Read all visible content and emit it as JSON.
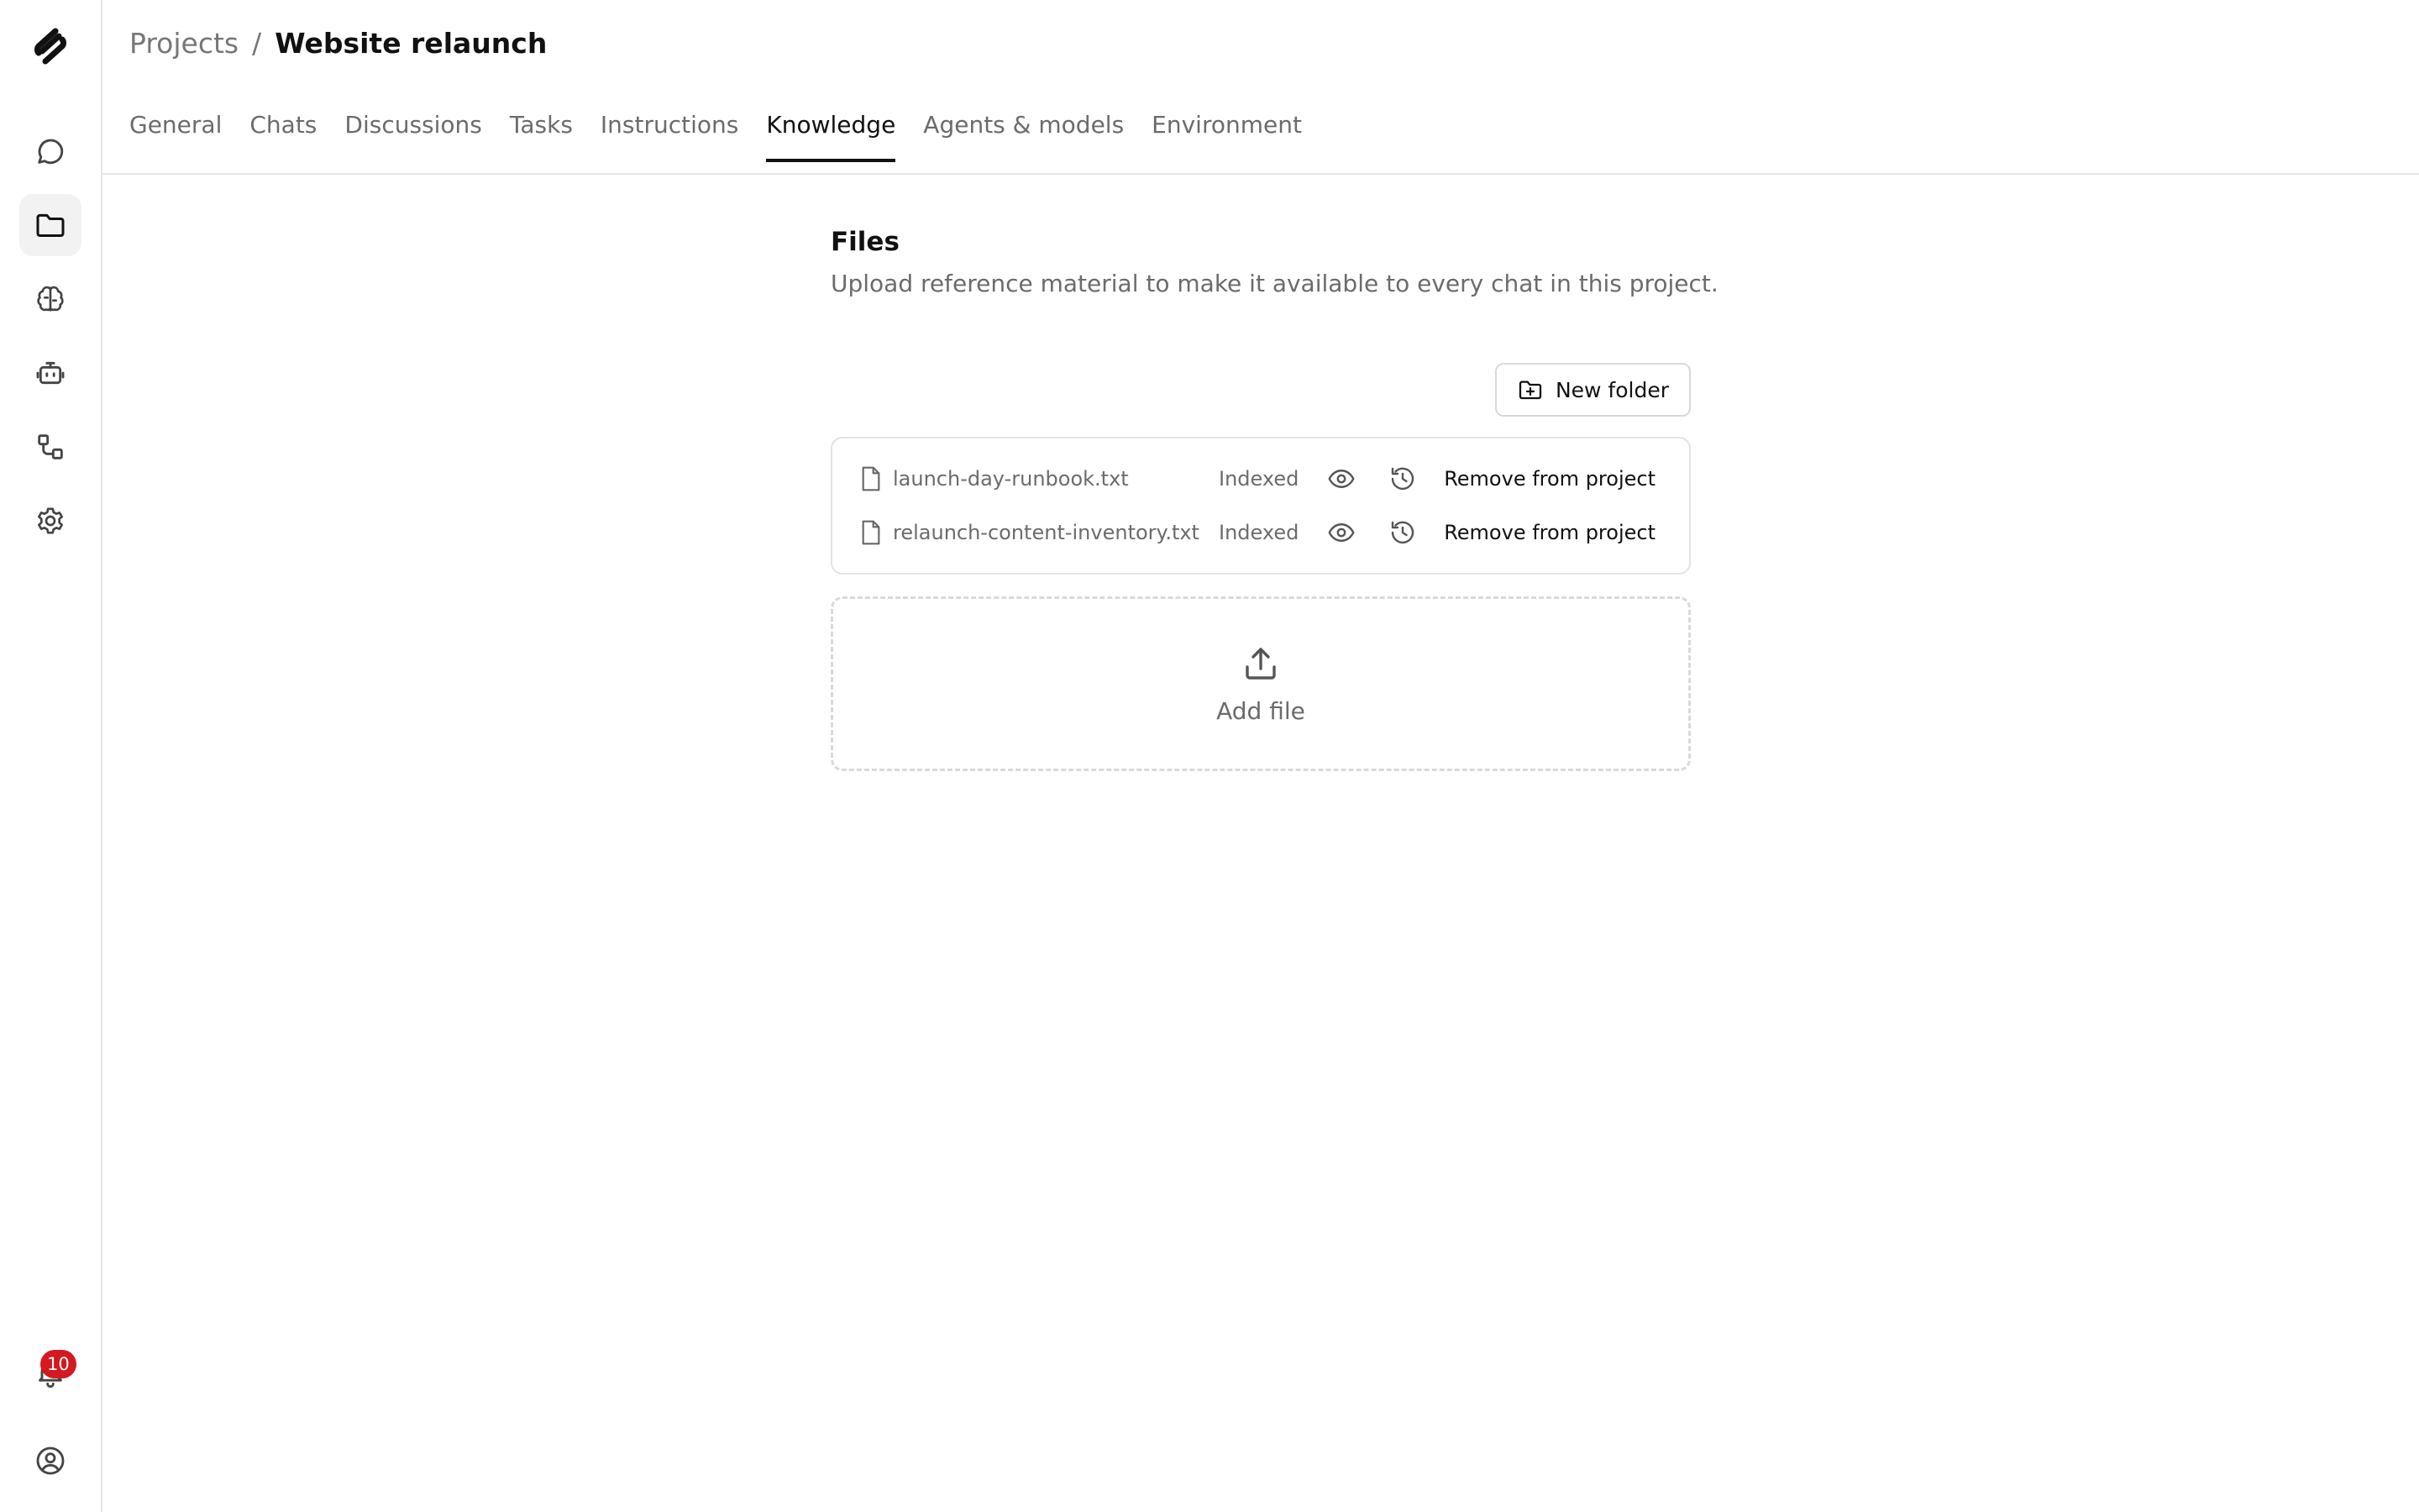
{
  "sidebar": {
    "logo": "app-logo-icon",
    "items": [
      {
        "name": "chats",
        "icon": "chat-bubble-icon",
        "active": false
      },
      {
        "name": "projects",
        "icon": "folder-icon",
        "active": true
      },
      {
        "name": "knowledge",
        "icon": "brain-icon",
        "active": false
      },
      {
        "name": "agents",
        "icon": "robot-icon",
        "active": false
      },
      {
        "name": "workflows",
        "icon": "workflow-icon",
        "active": false
      },
      {
        "name": "settings",
        "icon": "gear-icon",
        "active": false
      }
    ],
    "notifications": {
      "icon": "bell-icon",
      "count": "10"
    },
    "account": {
      "icon": "user-circle-icon"
    }
  },
  "breadcrumb": {
    "parent": "Projects",
    "separator": "/",
    "current": "Website relaunch"
  },
  "tabs": [
    {
      "label": "General",
      "active": false
    },
    {
      "label": "Chats",
      "active": false
    },
    {
      "label": "Discussions",
      "active": false
    },
    {
      "label": "Tasks",
      "active": false
    },
    {
      "label": "Instructions",
      "active": false
    },
    {
      "label": "Knowledge",
      "active": true
    },
    {
      "label": "Agents & models",
      "active": false
    },
    {
      "label": "Environment",
      "active": false
    }
  ],
  "files_section": {
    "title": "Files",
    "description": "Upload reference material to make it available to every chat in this project.",
    "new_folder_label": "New folder",
    "files": [
      {
        "name": "launch-day-runbook.txt",
        "status": "Indexed",
        "remove_label": "Remove from project"
      },
      {
        "name": "relaunch-content-inventory.txt",
        "status": "Indexed",
        "remove_label": "Remove from project"
      }
    ],
    "add_file_label": "Add file"
  },
  "colors": {
    "accent": "#111111",
    "muted_text": "#6b6b6b",
    "border": "#e3e3e3",
    "badge": "#d41920"
  }
}
